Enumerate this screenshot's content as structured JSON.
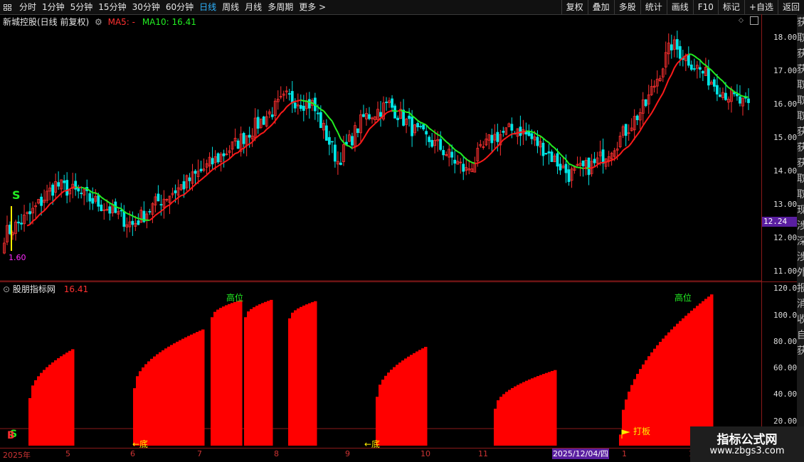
{
  "toolbar": {
    "left_items": [
      {
        "label": "分时",
        "active": false
      },
      {
        "label": "1分钟",
        "active": false
      },
      {
        "label": "5分钟",
        "active": false
      },
      {
        "label": "15分钟",
        "active": false
      },
      {
        "label": "30分钟",
        "active": false
      },
      {
        "label": "60分钟",
        "active": false
      },
      {
        "label": "日线",
        "active": true
      },
      {
        "label": "周线",
        "active": false
      },
      {
        "label": "月线",
        "active": false
      },
      {
        "label": "多周期",
        "active": false
      },
      {
        "label": "更多 >",
        "active": false
      }
    ],
    "right_items": [
      "复权",
      "叠加",
      "多股",
      "统计",
      "画线",
      "F10",
      "标记",
      "+自选",
      "返回"
    ]
  },
  "stock_title": "新城控股(日线 前复权)",
  "ma5_label": "MA5: -",
  "ma10_label": "MA10: 16.41",
  "price_axis": [
    "18.00",
    "17.00",
    "16.00",
    "15.00",
    "14.00",
    "13.00",
    "12.00",
    "11.00"
  ],
  "current_price": "12.24",
  "indicator_title": "股朋指标网",
  "indicator_value": "16.41",
  "indicator_axis": [
    "120.0",
    "100.0",
    "80.00",
    "60.00",
    "40.00",
    "20.00"
  ],
  "annotations": {
    "high_position": "高位",
    "bottom_left": "←底",
    "bottom_mid": "←底",
    "limit_up": "打板",
    "signal_s": "S",
    "signal_b": "B",
    "low_mark": "1.60"
  },
  "date_axis": [
    "2025年",
    "5",
    "6",
    "7",
    "8",
    "9",
    "10",
    "11",
    "1",
    "1"
  ],
  "selected_date": "2025/12/04/四",
  "side_strip_chars": [
    "获",
    "取",
    "获",
    "获",
    "取",
    "取",
    "取",
    "获",
    "获",
    "获",
    "取",
    "取",
    "现",
    "涉",
    "深",
    "涉",
    "外",
    "报",
    "消",
    "收",
    "自",
    "获"
  ],
  "watermark": {
    "title": "指标公式网",
    "url": "www.zbgs3.com"
  },
  "colors": {
    "up": "#ff3030",
    "down": "#00e5e5",
    "ma_red": "#ff1a1a",
    "ma_green": "#22ee22",
    "bar": "#ff0000",
    "accent": "#5a1fa0"
  },
  "chart_data": [
    {
      "type": "candlestick",
      "title": "新城控股(日线 前复权)",
      "ylim": [
        10.7,
        18.7
      ],
      "x_ticks": [
        "2025年",
        "5",
        "6",
        "7",
        "8",
        "9",
        "10",
        "11",
        "12",
        "1"
      ],
      "series": [
        {
          "name": "MA10",
          "last": 16.41
        }
      ],
      "close_trend": [
        12.1,
        12.7,
        13.6,
        13.3,
        12.9,
        12.4,
        13.1,
        13.6,
        14.2,
        14.8,
        15.5,
        16.2,
        16.0,
        14.3,
        15.6,
        16.0,
        15.2,
        14.7,
        14.0,
        15.0,
        15.3,
        14.7,
        13.9,
        14.2,
        15.0,
        16.0,
        17.8,
        17.1,
        16.4,
        15.9
      ]
    },
    {
      "type": "bar",
      "title": "股朋指标网",
      "ylim": [
        0,
        125
      ],
      "blocks": [
        {
          "start": "2025年",
          "peak": 75
        },
        {
          "start": "6",
          "peak": 90
        },
        {
          "start": "7",
          "peak": 112
        },
        {
          "start": "8",
          "peak": 111
        },
        {
          "start": "9",
          "peak": 77
        },
        {
          "start": "11",
          "peak": 59
        },
        {
          "start": "1",
          "peak": 117
        }
      ]
    }
  ]
}
